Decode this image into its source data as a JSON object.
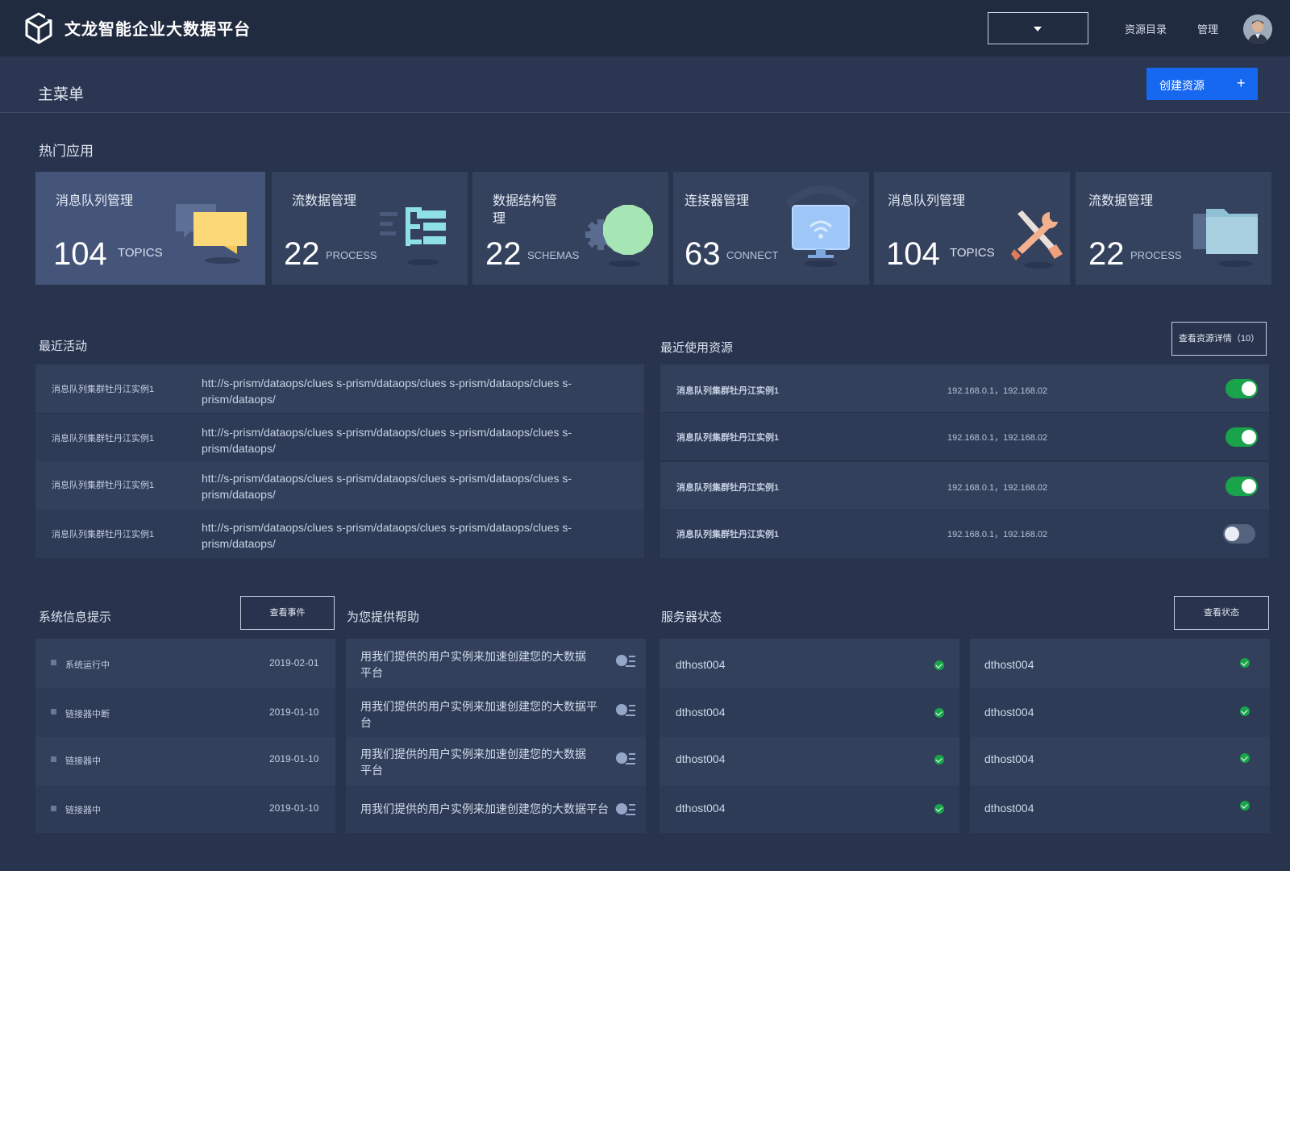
{
  "header": {
    "app_title": "文龙智能企业大数据平台",
    "nav_catalog": "资源目录",
    "nav_admin": "管理"
  },
  "menubar": {
    "title": "主菜单",
    "create_label": "创建资源",
    "create_plus": "+"
  },
  "hot_apps": {
    "title": "热门应用",
    "cards": [
      {
        "title": "消息队列管理",
        "count": "104",
        "unit": "TOPICS",
        "icon": "chat-bubbles-icon"
      },
      {
        "title": "流数据管理",
        "count": "22",
        "unit": "PROCESS",
        "icon": "list-icon"
      },
      {
        "title": "数据结构管理",
        "count": "22",
        "unit": "SCHEMAS",
        "icon": "gears-icon"
      },
      {
        "title": "连接器管理",
        "count": "63",
        "unit": "CONNECT",
        "icon": "monitor-wifi-icon"
      },
      {
        "title": "消息队列管理",
        "count": "104",
        "unit": "TOPICS",
        "icon": "tools-icon"
      },
      {
        "title": "流数据管理",
        "count": "22",
        "unit": "PROCESS",
        "icon": "folder-icon"
      }
    ]
  },
  "recent_activity": {
    "title": "最近活动",
    "rows": [
      {
        "name": "消息队列集群牡丹江实例1",
        "url": "htt://s-prism/dataops/clues s-prism/dataops/clues s-prism/dataops/clues s-prism/dataops/"
      },
      {
        "name": "消息队列集群牡丹江实例1",
        "url": "htt://s-prism/dataops/clues s-prism/dataops/clues s-prism/dataops/clues s-prism/dataops/"
      },
      {
        "name": "消息队列集群牡丹江实例1",
        "url": "htt://s-prism/dataops/clues s-prism/dataops/clues s-prism/dataops/clues s-prism/dataops/"
      },
      {
        "name": "消息队列集群牡丹江实例1",
        "url": "htt://s-prism/dataops/clues s-prism/dataops/clues s-prism/dataops/clues s-prism/dataops/"
      }
    ]
  },
  "recent_resources": {
    "title": "最近使用资源",
    "details_button": "查看资源详情（10）",
    "rows": [
      {
        "name": "消息队列集群牡丹江实例1",
        "ips": "192.168.0.1，192.168.02",
        "enabled": true
      },
      {
        "name": "消息队列集群牡丹江实例1",
        "ips": "192.168.0.1，192.168.02",
        "enabled": true
      },
      {
        "name": "消息队列集群牡丹江实例1",
        "ips": "192.168.0.1，192.168.02",
        "enabled": true
      },
      {
        "name": "消息队列集群牡丹江实例1",
        "ips": "192.168.0.1，192.168.02",
        "enabled": false
      }
    ]
  },
  "system_info": {
    "title": "系统信息提示",
    "events_button": "查看事件",
    "rows": [
      {
        "label": "系统运行中",
        "date": "2019-02-01"
      },
      {
        "label": "链接器中断",
        "date": "2019-01-10"
      },
      {
        "label": "链接器中",
        "date": "2019-01-10"
      },
      {
        "label": "链接器中",
        "date": "2019-01-10"
      }
    ]
  },
  "help": {
    "title": "为您提供帮助",
    "rows": [
      {
        "text": "用我们提供的用户实例来加速创建您的大数据平台"
      },
      {
        "text": "用我们提供的用户实例来加速创建您的大数据平台"
      },
      {
        "text": "用我们提供的用户实例来加速创建您的大数据平台"
      },
      {
        "text": "用我们提供的用户实例来加速创建您的大数据平台"
      }
    ]
  },
  "server_status": {
    "title": "服务器状态",
    "status_button": "查看状态",
    "hosts_left": [
      "dthost004",
      "dthost004",
      "dthost004",
      "dthost004"
    ],
    "hosts_right": [
      "dthost004",
      "dthost004",
      "dthost004",
      "dthost004"
    ]
  },
  "colors": {
    "primary": "#1668f0",
    "toggle_on": "#19a34a",
    "status_ok": "#18a64b",
    "topbar": "#212b3f",
    "background": "#28344d"
  }
}
